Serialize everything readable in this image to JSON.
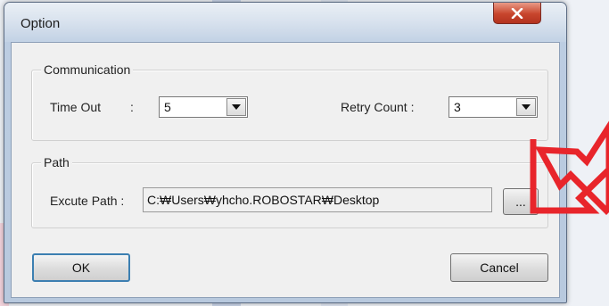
{
  "window": {
    "title": "Option"
  },
  "communication": {
    "group_label": "Communication",
    "timeout_label": "Time Out",
    "timeout_colon": ":",
    "timeout_value": "5",
    "retry_label": "Retry Count :",
    "retry_value": "3"
  },
  "path": {
    "group_label": "Path",
    "execute_label": "Excute Path :",
    "execute_value": "C:₩Users₩yhcho.ROBOSTAR₩Desktop",
    "browse_label": "..."
  },
  "buttons": {
    "ok_label": "OK",
    "cancel_label": "Cancel"
  },
  "colors": {
    "annotation_arrow": "#e8252b",
    "close_button": "#c8452d",
    "default_button_border": "#3c7fb1"
  },
  "icons": {
    "close": "close-icon",
    "dropdown": "chevron-down-icon",
    "annotation": "red-arrow-annotation"
  }
}
